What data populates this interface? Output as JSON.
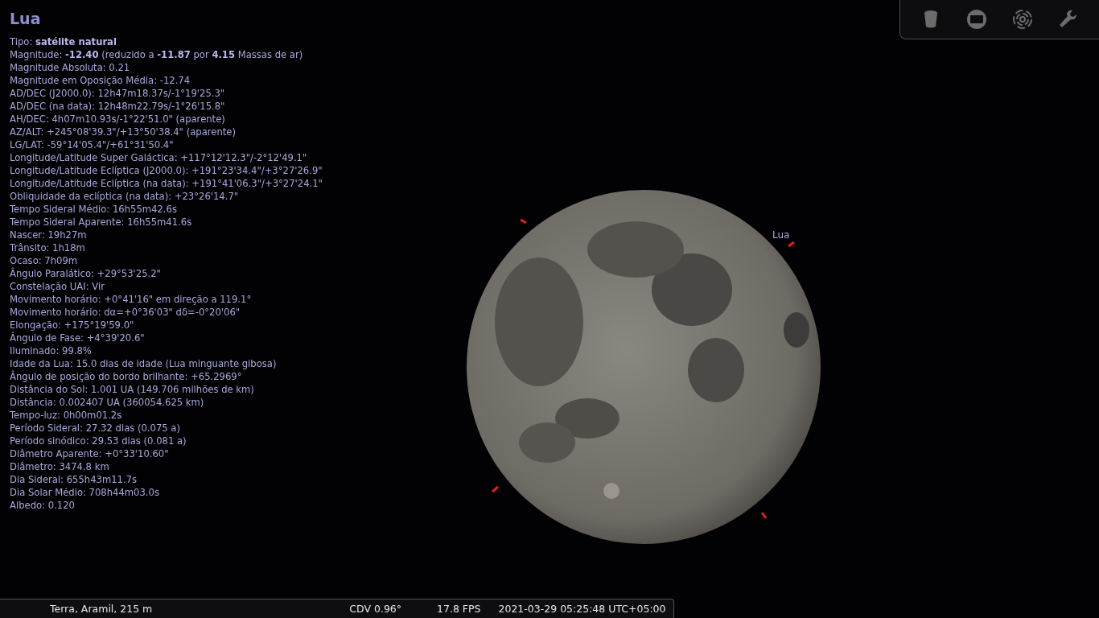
{
  "title": "Lua",
  "info_lines": [
    "Tipo: **satélite natural**",
    "Magnitude: **-12.40** (reduzido a **-11.87** por **4.15** Massas de ar)",
    "Magnitude Absoluta: 0.21",
    "Magnitude em Oposição Média: -12.74",
    "AD/DEC (J2000.0): 12h47m18.37s/-1°19'25.3\"",
    "AD/DEC (na data): 12h48m22.79s/-1°26'15.8\"",
    "AH/DEC: 4h07m10.93s/-1°22'51.0\" (aparente)",
    "AZ/ALT: +245°08'39.3\"/+13°50'38.4\" (aparente)",
    "LG/LAT: -59°14'05.4\"/+61°31'50.4\"",
    "Longitude/Latitude Super Galáctica: +117°12'12.3\"/-2°12'49.1\"",
    "Longitude/Latitude Eclíptica (J2000.0): +191°23'34.4\"/+3°27'26.9\"",
    "Longitude/Latitude Eclíptica (na data): +191°41'06.3\"/+3°27'24.1\"",
    "Obliquidade da eclíptica (na data): +23°26'14.7\"",
    "Tempo Sideral Médio: 16h55m42.6s",
    "Tempo Sideral Aparente: 16h55m41.6s",
    "Nascer: 19h27m",
    "Trânsito: 1h18m",
    "Ocaso: 7h09m",
    "Ângulo Paralático: +29°53'25.2\"",
    "Constelação UAI: Vir",
    "Movimento horário: +0°41'16\" em direção a 119.1°",
    "Movimento horário: dα=+0°36'03\" dδ=-0°20'06\"",
    "Elongação: +175°19'59.0\"",
    "Ângulo de Fase: +4°39'20.6\"",
    "Iluminado: 99.8%",
    "Idade da Lua: 15.0 dias de idade (Lua minguante gibosa)",
    "Ângulo de posição do bordo brilhante: +65.2969°",
    "Distância do Sol: 1.001 UA (149.706 milhões de km)",
    "Distância: 0.002407 UA (360054.625 km)",
    "Tempo-luz: 0h00m01.2s",
    "Período Sideral: 27.32 dias (0.075 a)",
    "Período sinódico: 29.53 dias (0.081 a)",
    "Diâmetro Aparente: +0°33'10.60\"",
    "Diâmetro: 3474.8 km",
    "Dia Sideral: 655h43m11.7s",
    "Dia Solar Médio: 708h44m03.0s",
    "Albedo: 0.120"
  ],
  "sky_label": "Lua",
  "toolbar": [
    {
      "kind": "cylinder"
    },
    {
      "kind": "screen"
    },
    {
      "kind": "target"
    },
    {
      "kind": "wrench"
    }
  ],
  "status_bar": {
    "location": "Terra, Aramil, 215 m",
    "fov": "CDV 0.96°",
    "fps": "17.8 FPS",
    "datetime": "2021-03-29 05:25:48 UTC+05:00"
  }
}
